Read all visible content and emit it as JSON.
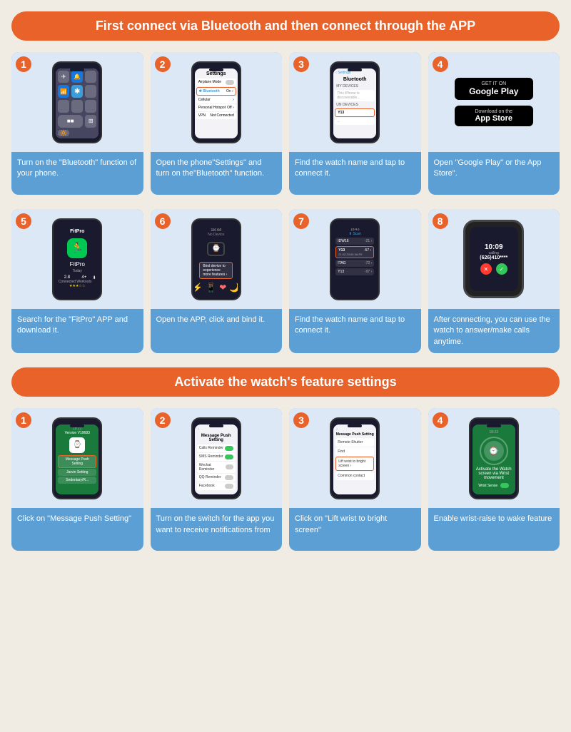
{
  "section1": {
    "title": "First connect via Bluetooth and then connect through the APP",
    "steps": [
      {
        "number": "1",
        "label": "Turn on the \"Bluetooth\" function of your phone."
      },
      {
        "number": "2",
        "label": "Open the phone\"Settings\" and turn on the\"Bluetooth\" function."
      },
      {
        "number": "3",
        "label": "Find the watch name and tap to connect it."
      },
      {
        "number": "4",
        "label": "Open \"Google Play\" or the App Store\"."
      },
      {
        "number": "5",
        "label": "Search for the \"FitPro\" APP and download it."
      },
      {
        "number": "6",
        "label": "Open the APP, click and bind it."
      },
      {
        "number": "7",
        "label": "Find the watch name and tap to connect it."
      },
      {
        "number": "8",
        "label": "After connecting, you can use the watch to answer/make calls anytime."
      }
    ],
    "step4": {
      "googlePlay": "GET IT ON\nGoogle Play",
      "appStore": "Download on the\nApp Store"
    }
  },
  "section2": {
    "title": "Activate the watch's feature settings",
    "steps": [
      {
        "number": "1",
        "label": "Click on \"Message Push Setting\""
      },
      {
        "number": "2",
        "label": "Turn on the switch for the app you want to receive notifications from"
      },
      {
        "number": "3",
        "label": "Click on \"Lift wrist to bright screen\""
      },
      {
        "number": "4",
        "label": "Enable wrist-raise to wake feature"
      }
    ]
  }
}
